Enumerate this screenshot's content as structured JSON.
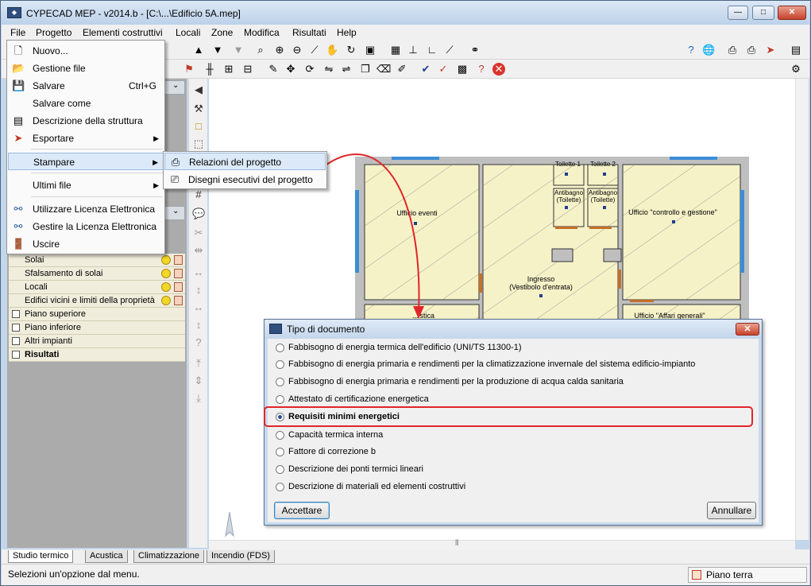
{
  "window": {
    "title": "CYPECAD MEP - v2014.b - [C:\\...\\Edificio 5A.mep]"
  },
  "menubar": [
    {
      "label": "File"
    },
    {
      "label": "Progetto"
    },
    {
      "label": "Elementi costruttivi"
    },
    {
      "label": "Locali"
    },
    {
      "label": "Zone"
    },
    {
      "label": "Modifica"
    },
    {
      "label": "Risultati"
    },
    {
      "label": "Help"
    }
  ],
  "file_menu": {
    "items": [
      {
        "label": "Nuovo...",
        "icon": "new-file-icon"
      },
      {
        "label": "Gestione file",
        "icon": "folder-open-icon"
      },
      {
        "label": "Salvare",
        "shortcut": "Ctrl+G",
        "icon": "floppy-disk-icon"
      },
      {
        "label": "Salvare come"
      },
      {
        "label": "Descrizione della struttura",
        "icon": "structure-icon"
      },
      {
        "label": "Esportare",
        "icon": "export-icon"
      },
      {
        "label": "Stampare"
      },
      {
        "label": "Ultimi file"
      },
      {
        "label": "Utilizzare Licenza Elettronica",
        "icon": "network-license-icon"
      },
      {
        "label": "Gestire la Licenza Elettronica",
        "icon": "network-license-icon"
      },
      {
        "label": "Uscire",
        "icon": "exit-door-icon"
      }
    ]
  },
  "print_submenu": {
    "items": [
      {
        "label": "Relazioni del progetto",
        "icon": "printer-icon"
      },
      {
        "label": "Disegni esecutivi del progetto",
        "icon": "plotter-icon"
      }
    ]
  },
  "left_panel": {
    "rows": [
      {
        "label": "Solai",
        "checkbox": false,
        "indicators": true
      },
      {
        "label": "Sfalsamento di solai",
        "checkbox": false,
        "indicators": true
      },
      {
        "label": "Locali",
        "checkbox": false,
        "indicators": true
      },
      {
        "label": "Edifici vicini e limiti della proprietà",
        "checkbox": false,
        "indicators": true
      },
      {
        "label": "Piano superiore",
        "checkbox": true
      },
      {
        "label": "Piano inferiore",
        "checkbox": true
      },
      {
        "label": "Altri impianti",
        "checkbox": true
      },
      {
        "label": "Risultati",
        "checkbox": true,
        "bold": true
      }
    ]
  },
  "plan": {
    "rooms": [
      {
        "label": "Ufficio eventi"
      },
      {
        "label": "Toilette 1"
      },
      {
        "label": "Toilette 2"
      },
      {
        "label": "Antibagno\n(Toilette)"
      },
      {
        "label": "Antibagno\n(Toilette)"
      },
      {
        "label": "Ufficio \"controllo e gestione\""
      },
      {
        "label": "Ingresso\n(Vestibolo d'entrata)"
      },
      {
        "label": "...istica"
      },
      {
        "label": "Ufficio \"Affari generali\""
      }
    ]
  },
  "dialog": {
    "title": "Tipo di documento",
    "options": [
      {
        "label": "Fabbisogno di energia termica dell'edificio (UNI/TS 11300-1)",
        "selected": false
      },
      {
        "label": "Fabbisogno di energia primaria e rendimenti per la climatizzazione invernale del sistema edificio-impianto",
        "selected": false
      },
      {
        "label": "Fabbisogno di energia primaria e rendimenti per la produzione di acqua calda sanitaria",
        "selected": false
      },
      {
        "label": "Attestato di certificazione energetica",
        "selected": false
      },
      {
        "label": "Requisiti minimi energetici",
        "selected": true
      },
      {
        "label": "Capacità termica interna",
        "selected": false
      },
      {
        "label": "Fattore di correzione b",
        "selected": false
      },
      {
        "label": "Descrizione dei ponti termici lineari",
        "selected": false
      },
      {
        "label": "Descrizione di materiali ed elementi costruttivi",
        "selected": false
      }
    ],
    "accept_label": "Accettare",
    "cancel_label": "Annullare"
  },
  "bottom_tabs": [
    {
      "label": "Studio termico",
      "active": true
    },
    {
      "label": "Acustica",
      "active": false
    },
    {
      "label": "Climatizzazione",
      "active": false
    },
    {
      "label": "Incendio (FDS)",
      "active": false
    }
  ],
  "status": {
    "message": "Selezioni un'opzione dal menu.",
    "floor": "Piano terra"
  },
  "colors": {
    "highlight": "#e0262b",
    "selection_bg": "#dbe9f8",
    "floor_fill": "#f6f2c8",
    "window_blue": "#3c8dd6"
  }
}
